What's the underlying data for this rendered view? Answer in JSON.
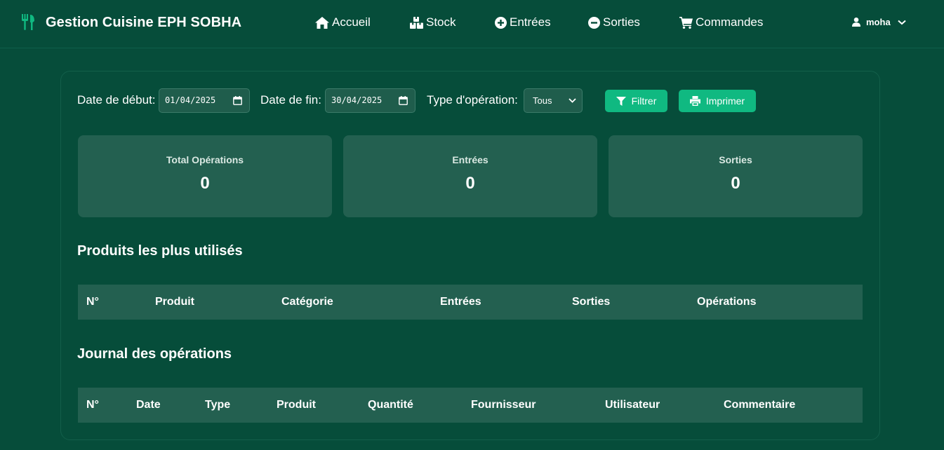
{
  "app": {
    "title": "Gestion Cuisine EPH SOBHA",
    "logo_icon": "utensils-icon",
    "accent_color": "#10b981"
  },
  "nav": {
    "items": [
      {
        "label": "Accueil",
        "icon": "home-icon"
      },
      {
        "label": "Stock",
        "icon": "boxes-icon"
      },
      {
        "label": "Entrées",
        "icon": "plus-circle-icon"
      },
      {
        "label": "Sorties",
        "icon": "minus-circle-icon"
      },
      {
        "label": "Commandes",
        "icon": "cart-icon"
      }
    ],
    "user": {
      "name": "moha",
      "icon": "user-icon"
    }
  },
  "filters": {
    "start_label": "Date de début:",
    "start_value": "01/04/2025",
    "end_label": "Date de fin:",
    "end_value": "30/04/2025",
    "type_label": "Type d'opération:",
    "type_value": "Tous",
    "filter_button": "Filtrer",
    "print_button": "Imprimer"
  },
  "stats": [
    {
      "label": "Total Opérations",
      "value": "0"
    },
    {
      "label": "Entrées",
      "value": "0"
    },
    {
      "label": "Sorties",
      "value": "0"
    }
  ],
  "top_products": {
    "title": "Produits les plus utilisés",
    "columns": [
      "N°",
      "Produit",
      "Catégorie",
      "Entrées",
      "Sorties",
      "Opérations"
    ]
  },
  "journal": {
    "title": "Journal des opérations",
    "columns": [
      "N°",
      "Date",
      "Type",
      "Produit",
      "Quantité",
      "Fournisseur",
      "Utilisateur",
      "Commentaire"
    ]
  }
}
